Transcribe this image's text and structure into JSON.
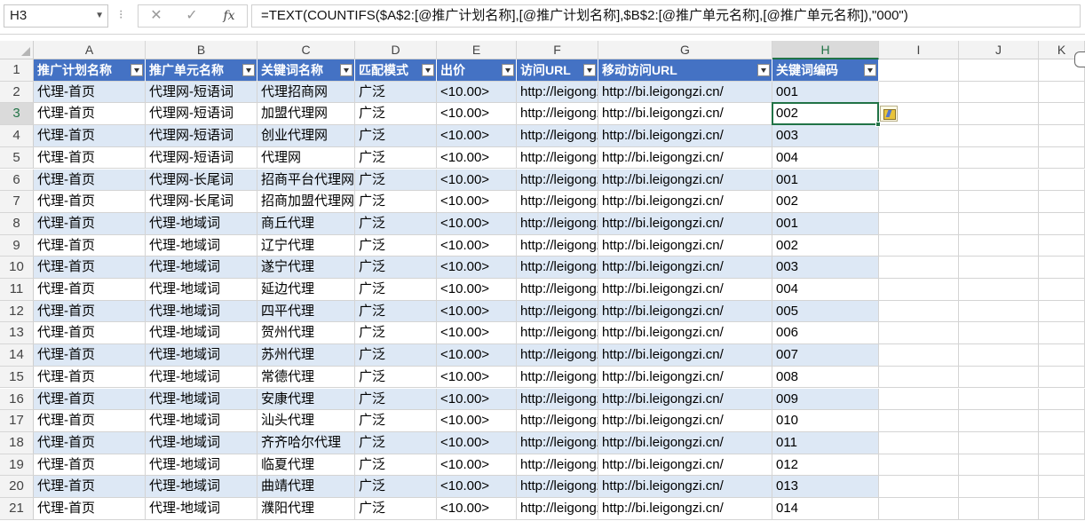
{
  "formula_bar": {
    "name_box": "H3",
    "separator": "⁝",
    "cancel_symbol": "✕",
    "enter_symbol": "✓",
    "fx_label": "fx",
    "formula": "=TEXT(COUNTIFS($A$2:[@推广计划名称],[@推广计划名称],$B$2:[@推广单元名称],[@推广单元名称]),\"000\")"
  },
  "columns": [
    "A",
    "B",
    "C",
    "D",
    "E",
    "F",
    "G",
    "H",
    "I",
    "J",
    "K"
  ],
  "selected_column": "H",
  "selected_row": 3,
  "headers": [
    "推广计划名称",
    "推广单元名称",
    "关键词名称",
    "匹配模式",
    "出价",
    "访问URL",
    "移动访问URL",
    "关键词编码"
  ],
  "rows": [
    [
      "代理-首页",
      "代理网-短语词",
      "代理招商网",
      "广泛",
      "<10.00>",
      "http://leigongzi.cn/",
      "http://bi.leigongzi.cn/",
      "001"
    ],
    [
      "代理-首页",
      "代理网-短语词",
      "加盟代理网",
      "广泛",
      "<10.00>",
      "http://leigongzi.cn/",
      "http://bi.leigongzi.cn/",
      "002"
    ],
    [
      "代理-首页",
      "代理网-短语词",
      "创业代理网",
      "广泛",
      "<10.00>",
      "http://leigongzi.cn/",
      "http://bi.leigongzi.cn/",
      "003"
    ],
    [
      "代理-首页",
      "代理网-短语词",
      "代理网",
      "广泛",
      "<10.00>",
      "http://leigongzi.cn/",
      "http://bi.leigongzi.cn/",
      "004"
    ],
    [
      "代理-首页",
      "代理网-长尾词",
      "招商平台代理网",
      "广泛",
      "<10.00>",
      "http://leigongzi.cn/",
      "http://bi.leigongzi.cn/",
      "001"
    ],
    [
      "代理-首页",
      "代理网-长尾词",
      "招商加盟代理网",
      "广泛",
      "<10.00>",
      "http://leigongzi.cn/",
      "http://bi.leigongzi.cn/",
      "002"
    ],
    [
      "代理-首页",
      "代理-地域词",
      "商丘代理",
      "广泛",
      "<10.00>",
      "http://leigongzi.cn/",
      "http://bi.leigongzi.cn/",
      "001"
    ],
    [
      "代理-首页",
      "代理-地域词",
      "辽宁代理",
      "广泛",
      "<10.00>",
      "http://leigongzi.cn/",
      "http://bi.leigongzi.cn/",
      "002"
    ],
    [
      "代理-首页",
      "代理-地域词",
      "遂宁代理",
      "广泛",
      "<10.00>",
      "http://leigongzi.cn/",
      "http://bi.leigongzi.cn/",
      "003"
    ],
    [
      "代理-首页",
      "代理-地域词",
      "延边代理",
      "广泛",
      "<10.00>",
      "http://leigongzi.cn/",
      "http://bi.leigongzi.cn/",
      "004"
    ],
    [
      "代理-首页",
      "代理-地域词",
      "四平代理",
      "广泛",
      "<10.00>",
      "http://leigongzi.cn/",
      "http://bi.leigongzi.cn/",
      "005"
    ],
    [
      "代理-首页",
      "代理-地域词",
      "贺州代理",
      "广泛",
      "<10.00>",
      "http://leigongzi.cn/",
      "http://bi.leigongzi.cn/",
      "006"
    ],
    [
      "代理-首页",
      "代理-地域词",
      "苏州代理",
      "广泛",
      "<10.00>",
      "http://leigongzi.cn/",
      "http://bi.leigongzi.cn/",
      "007"
    ],
    [
      "代理-首页",
      "代理-地域词",
      "常德代理",
      "广泛",
      "<10.00>",
      "http://leigongzi.cn/",
      "http://bi.leigongzi.cn/",
      "008"
    ],
    [
      "代理-首页",
      "代理-地域词",
      "安康代理",
      "广泛",
      "<10.00>",
      "http://leigongzi.cn/",
      "http://bi.leigongzi.cn/",
      "009"
    ],
    [
      "代理-首页",
      "代理-地域词",
      "汕头代理",
      "广泛",
      "<10.00>",
      "http://leigongzi.cn/",
      "http://bi.leigongzi.cn/",
      "010"
    ],
    [
      "代理-首页",
      "代理-地域词",
      "齐齐哈尔代理",
      "广泛",
      "<10.00>",
      "http://leigongzi.cn/",
      "http://bi.leigongzi.cn/",
      "011"
    ],
    [
      "代理-首页",
      "代理-地域词",
      "临夏代理",
      "广泛",
      "<10.00>",
      "http://leigongzi.cn/",
      "http://bi.leigongzi.cn/",
      "012"
    ],
    [
      "代理-首页",
      "代理-地域词",
      "曲靖代理",
      "广泛",
      "<10.00>",
      "http://leigongzi.cn/",
      "http://bi.leigongzi.cn/",
      "013"
    ],
    [
      "代理-首页",
      "代理-地域词",
      "濮阳代理",
      "广泛",
      "<10.00>",
      "http://leigongzi.cn/",
      "http://bi.leigongzi.cn/",
      "014"
    ]
  ],
  "colors": {
    "table_header": "#4472c4",
    "band_row": "#dde8f5",
    "selection": "#217346"
  },
  "icons": {
    "autofill_options": "flash-fill-options-icon",
    "name_box_dropdown": "chevron-down-icon"
  }
}
